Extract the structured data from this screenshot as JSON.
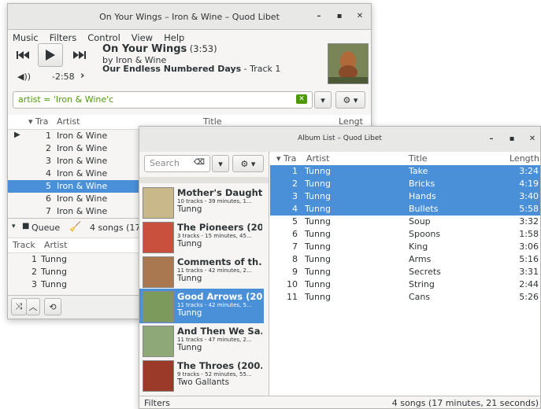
{
  "main": {
    "title": "On Your Wings – Iron & Wine – Quod Libet",
    "menu": [
      "Music",
      "Filters",
      "Control",
      "View",
      "Help"
    ],
    "now_playing": {
      "song": "On Your Wings",
      "duration": "(3:53)",
      "by": "by Iron & Wine",
      "album": "Our Endless Numbered Days",
      "track": " - Track 1",
      "remaining": "-2:58"
    },
    "search_value": "artist = 'Iron & Wine'c",
    "columns": {
      "track": "Tra",
      "artist": "Artist",
      "title": "Title",
      "length": "Lengt"
    },
    "rows": [
      {
        "n": "1",
        "artist": "Iron & Wine",
        "playing": true
      },
      {
        "n": "2",
        "artist": "Iron & Wine"
      },
      {
        "n": "3",
        "artist": "Iron & Wine"
      },
      {
        "n": "4",
        "artist": "Iron & Wine"
      },
      {
        "n": "5",
        "artist": "Iron & Wine",
        "selected": true
      },
      {
        "n": "6",
        "artist": "Iron & Wine"
      },
      {
        "n": "7",
        "artist": "Iron & Wine"
      }
    ],
    "queue": {
      "label": "Queue",
      "count": "4 songs (17:",
      "col_track": "Track",
      "col_artist": "Artist",
      "rows": [
        {
          "n": "1",
          "artist": "Tunng"
        },
        {
          "n": "2",
          "artist": "Tunng"
        },
        {
          "n": "3",
          "artist": "Tunng"
        }
      ]
    }
  },
  "album_list": {
    "title": "Album List – Quod Libet",
    "search_placeholder": "Search",
    "albums": [
      {
        "title": "Mother's Daught...",
        "info": "10 tracks - 39 minutes, 1...",
        "artist": "Tunng",
        "color": "#c9b98a"
      },
      {
        "title": "The Pioneers (20...",
        "info": "3 tracks - 15 minutes, 45...",
        "artist": "Tunng",
        "color": "#c8503c"
      },
      {
        "title": "Comments of th...",
        "info": "11 tracks - 42 minutes, 2...",
        "artist": "Tunng",
        "color": "#a97850"
      },
      {
        "title": "Good Arrows (20...",
        "info": "11 tracks - 42 minutes, 5...",
        "artist": "Tunng",
        "color": "#7c9a5c",
        "selected": true
      },
      {
        "title": "And Then We Sa...",
        "info": "11 tracks - 47 minutes, 2...",
        "artist": "Tunng",
        "color": "#8fa878"
      },
      {
        "title": "The Throes (200...",
        "info": "9 tracks - 52 minutes, 55...",
        "artist": "Two Gallants",
        "color": "#9c3a2a"
      }
    ],
    "columns": {
      "track": "Tra",
      "artist": "Artist",
      "title": "Title",
      "length": "Length"
    },
    "tracks": [
      {
        "n": "1",
        "artist": "Tunng",
        "title": "Take",
        "length": "3:24",
        "selected": true
      },
      {
        "n": "2",
        "artist": "Tunng",
        "title": "Bricks",
        "length": "4:19",
        "selected": true
      },
      {
        "n": "3",
        "artist": "Tunng",
        "title": "Hands",
        "length": "3:40",
        "selected": true
      },
      {
        "n": "4",
        "artist": "Tunng",
        "title": "Bullets",
        "length": "5:58",
        "selected": true
      },
      {
        "n": "5",
        "artist": "Tunng",
        "title": "Soup",
        "length": "3:32"
      },
      {
        "n": "6",
        "artist": "Tunng",
        "title": "Spoons",
        "length": "1:58"
      },
      {
        "n": "7",
        "artist": "Tunng",
        "title": "King",
        "length": "3:06"
      },
      {
        "n": "8",
        "artist": "Tunng",
        "title": "Arms",
        "length": "5:16"
      },
      {
        "n": "9",
        "artist": "Tunng",
        "title": "Secrets",
        "length": "3:31"
      },
      {
        "n": "10",
        "artist": "Tunng",
        "title": "String",
        "length": "2:44"
      },
      {
        "n": "11",
        "artist": "Tunng",
        "title": "Cans",
        "length": "5:26"
      }
    ],
    "status_left": "Filters",
    "status_right": "4 songs (17 minutes, 21 seconds)"
  },
  "colors": {
    "selection": "#4a90d9",
    "query": "#4e9a06"
  }
}
